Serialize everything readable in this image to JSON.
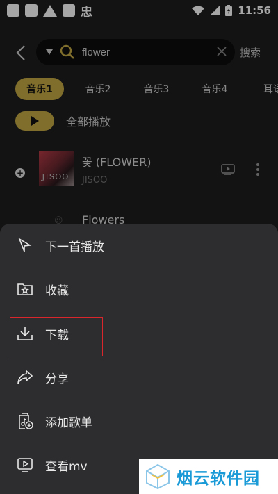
{
  "status_bar": {
    "time": "11:56",
    "left_char": "忠"
  },
  "search": {
    "query": "flower",
    "submit_label": "搜索"
  },
  "tabs": [
    "音乐1",
    "音乐2",
    "音乐3",
    "音乐4",
    "耳语"
  ],
  "play_all_label": "全部播放",
  "songs": [
    {
      "title": "꽃 (FLOWER)",
      "artist": "JISOO",
      "cover_text": "JISOO"
    },
    {
      "title": "Flowers"
    }
  ],
  "action_sheet": {
    "items": [
      {
        "label": "下一首播放",
        "icon": "play-next-icon"
      },
      {
        "label": "收藏",
        "icon": "favorite-folder-icon"
      },
      {
        "label": "下载",
        "icon": "download-icon"
      },
      {
        "label": "分享",
        "icon": "share-icon"
      },
      {
        "label": "添加歌单",
        "icon": "add-to-playlist-icon"
      },
      {
        "label": "查看mv",
        "icon": "mv-icon"
      }
    ]
  },
  "watermark": {
    "text": "烟云软件园"
  },
  "colors": {
    "accent": "#c5aa44",
    "highlight": "#d8262c",
    "sheet_bg": "#2d2d2f"
  }
}
